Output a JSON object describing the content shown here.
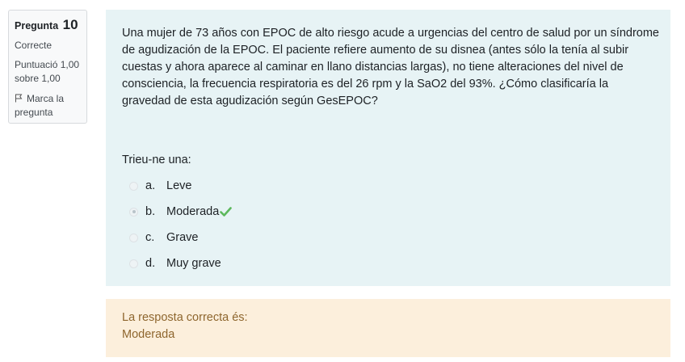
{
  "info": {
    "question_label": "Pregunta",
    "question_number": "10",
    "state": "Correcte",
    "grade_line1": "Puntuació 1,00",
    "grade_line2": "sobre 1,00",
    "flag_line1": "Marca la",
    "flag_line2": "pregunta"
  },
  "question": {
    "text": "Una mujer de 73 años con EPOC de alto riesgo acude a urgencias del centro de salud por un síndrome de agudización de la EPOC. El paciente refiere aumento de su disnea (antes sólo la tenía al subir cuestas y ahora aparece al caminar en llano distancias largas), no tiene alteraciones del nivel de consciencia, la frecuencia respiratoria es del 26 rpm y la SaO2 del 93%. ¿Cómo clasificaría la gravedad de esta agudización según GesEPOC?",
    "prompt": "Trieu-ne una:",
    "options": [
      {
        "letter": "a.",
        "label": "Leve",
        "selected": false
      },
      {
        "letter": "b.",
        "label": "Moderada",
        "selected": true,
        "correct": true
      },
      {
        "letter": "c.",
        "label": "Grave",
        "selected": false
      },
      {
        "letter": "d.",
        "label": "Muy grave",
        "selected": false
      }
    ]
  },
  "feedback": {
    "title": "La resposta correcta és:",
    "answer": "Moderada"
  },
  "colors": {
    "content_bg": "#e7f3f5",
    "feedback_bg": "#fcefdc",
    "feedback_text": "#8e662e",
    "check_green": "#5cb85c"
  },
  "icons": {
    "flag": "flag-icon",
    "correct": "check-icon"
  }
}
